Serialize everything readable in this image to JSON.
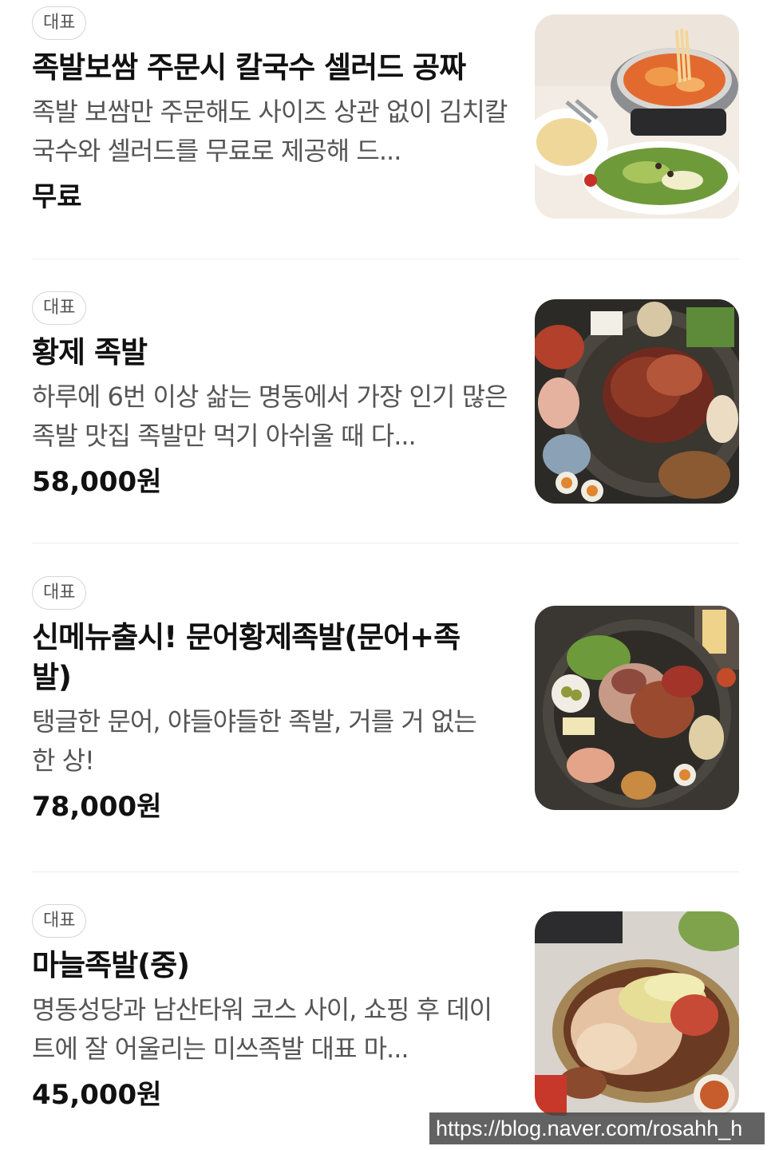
{
  "menu": {
    "items": [
      {
        "badge": "대표",
        "title": "족발보쌈 주문시 칼국수 셀러드 공짜",
        "description": "족발 보쌈만 주문해도 사이즈 상관 없이 김치칼국수와 셀러드를 무료로 제공해 드...",
        "price": "무료",
        "image": "noodle-soup-salad-photo"
      },
      {
        "badge": "대표",
        "title": "황제 족발",
        "description": "하루에 6번 이상 삶는 명동에서 가장 인기 많은 족발 맛집 족발만 먹기 아쉬울 때 다...",
        "price": "58,000원",
        "image": "emperor-jokbal-platter-photo"
      },
      {
        "badge": "대표",
        "title": "신메뉴출시! 문어황제족발(문어+족발)",
        "description": "탱글한 문어, 야들야들한 족발, 거를 거 없는 한 상!",
        "price": "78,000원",
        "image": "octopus-jokbal-platter-photo"
      },
      {
        "badge": "대표",
        "title": "마늘족발(중)",
        "description": "명동성당과 남산타워 코스 사이, 쇼핑 후 데이트에 잘 어울리는 미쓰족발 대표 마...",
        "price": "45,000원",
        "image": "garlic-jokbal-photo"
      }
    ]
  },
  "watermark": "https://blog.naver.com/rosahh_h"
}
